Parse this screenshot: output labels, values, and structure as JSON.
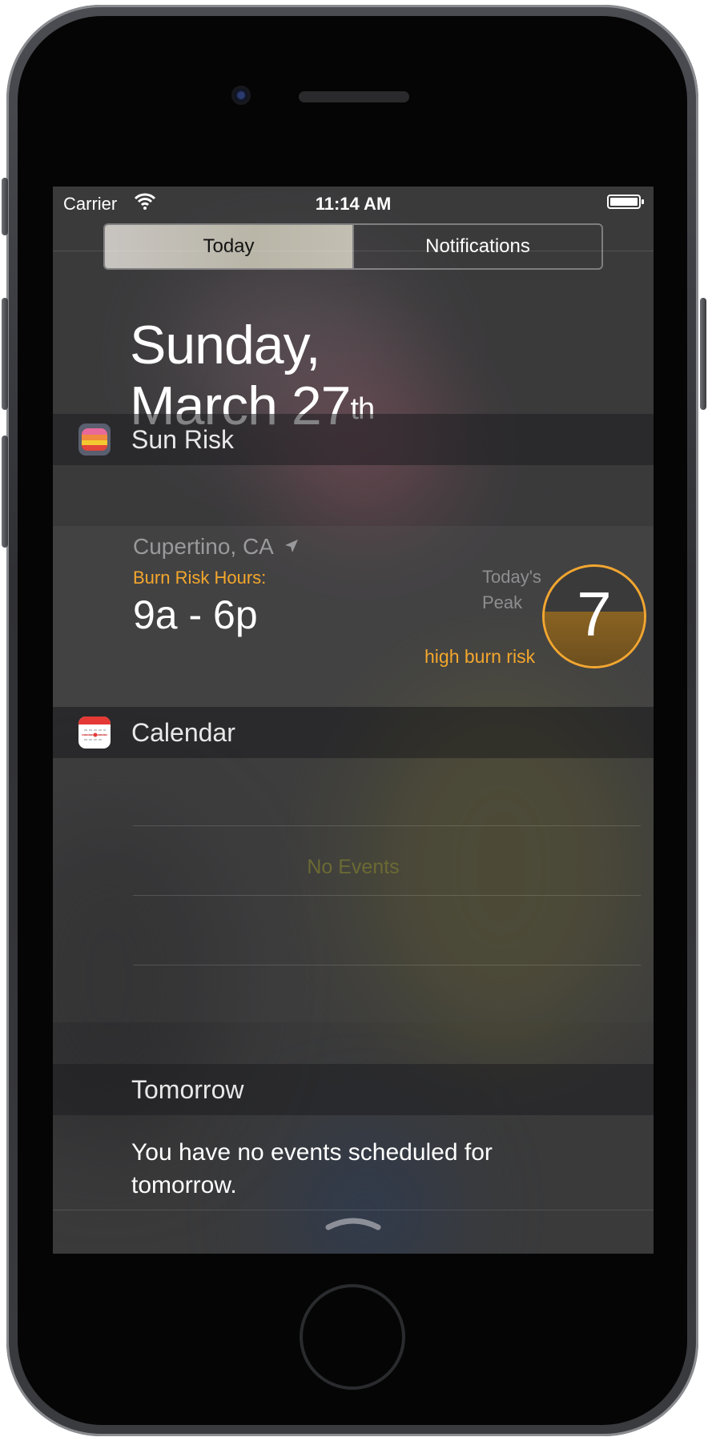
{
  "status_bar": {
    "carrier": "Carrier",
    "time": "11:14 AM"
  },
  "segmented_control": {
    "today_label": "Today",
    "notifications_label": "Notifications",
    "selected": "Today"
  },
  "date": {
    "line1": "Sunday,",
    "line2": "March 27",
    "ordinal_suffix": "th"
  },
  "sun_risk_widget": {
    "title": "Sun Risk",
    "location": "Cupertino, CA",
    "burn_risk_label": "Burn Risk Hours:",
    "burn_risk_hours": "9a - 6p",
    "peak_label_line1": "Today's",
    "peak_label_line2": "Peak",
    "uv_index": "7",
    "uv_fill_fraction": 0.55,
    "risk_text": "high burn risk",
    "accent_color": "#f4a72c"
  },
  "calendar_widget": {
    "title": "Calendar",
    "no_events_text": "No Events",
    "tomorrow_header": "Tomorrow",
    "tomorrow_message": "You have no events scheduled for tomorrow."
  },
  "icons": {
    "wifi": "wifi-icon",
    "battery": "battery-icon",
    "location": "location-arrow-icon",
    "grabber": "chevron-up-grabber-icon"
  }
}
